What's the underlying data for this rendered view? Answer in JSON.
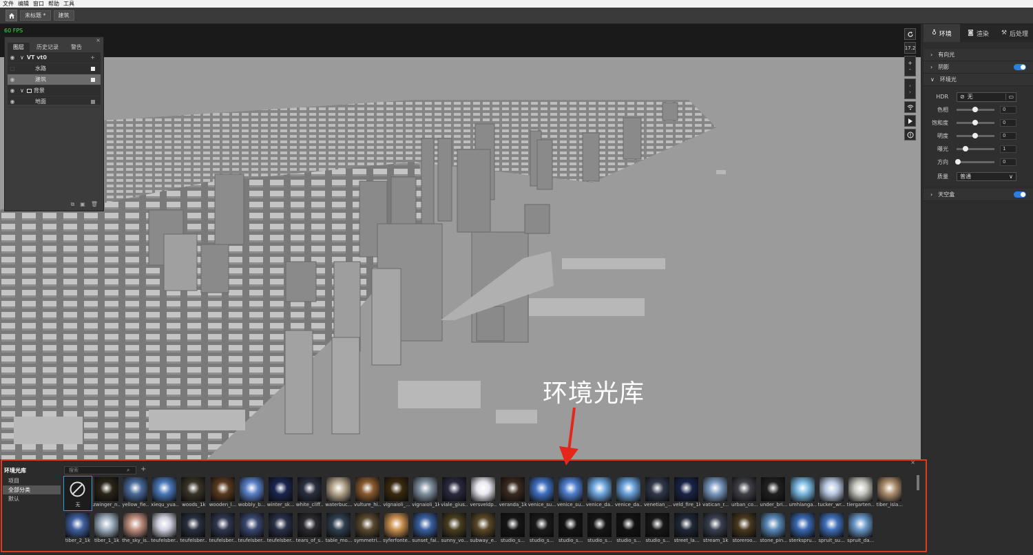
{
  "menu": [
    "文件",
    "编辑",
    "窗口",
    "帮助",
    "工具"
  ],
  "tabs": {
    "untitled": "未标题 *",
    "building": "建筑"
  },
  "viewport": {
    "fps": "60 FPS",
    "zoom": "17.2",
    "plus": "+",
    "minus": "-"
  },
  "layers": {
    "tabs": [
      "图层",
      "历史记录",
      "警告"
    ],
    "rows": [
      {
        "label": "VT vt0"
      },
      {
        "label": "水路"
      },
      {
        "label": "建筑"
      },
      {
        "label": "背景"
      },
      {
        "label": "地面"
      }
    ]
  },
  "right": {
    "tabs": [
      "环境",
      "渲染",
      "后处理"
    ],
    "sections": {
      "directional": "有向光",
      "shadow": "阴影",
      "ambient": "环境光",
      "skybox": "天空盒"
    },
    "hdr_label": "HDR",
    "hdr_value": "无",
    "params": [
      {
        "label": "色相",
        "value": "0",
        "fraction": 0.5
      },
      {
        "label": "饱和度",
        "value": "0",
        "fraction": 0.5
      },
      {
        "label": "明度",
        "value": "0",
        "fraction": 0.5
      },
      {
        "label": "曝光",
        "value": "1",
        "fraction": 0.2
      },
      {
        "label": "方向",
        "value": "0",
        "fraction": 0.0
      }
    ],
    "quality_label": "质量",
    "quality_value": "普通"
  },
  "library": {
    "title": "环境光库",
    "categories": [
      "项目",
      "全部分类",
      "默认"
    ],
    "search_placeholder": "搜索",
    "row1": [
      {
        "n": "无",
        "c": "#1e1e1e"
      },
      {
        "n": "zwinger_n...",
        "c": "#2a2418"
      },
      {
        "n": "yellow_fie...",
        "c": "#4a6a9a"
      },
      {
        "n": "xiequ_yua...",
        "c": "#4a78b8"
      },
      {
        "n": "woods_1k",
        "c": "#3a3428"
      },
      {
        "n": "wooden_l...",
        "c": "#5a3a20"
      },
      {
        "n": "wobbly_b...",
        "c": "#5a80c8"
      },
      {
        "n": "winter_sk...",
        "c": "#1a2650"
      },
      {
        "n": "white_cliff...",
        "c": "#2a3040"
      },
      {
        "n": "waterbuc...",
        "c": "#b8a890"
      },
      {
        "n": "vulture_hi...",
        "c": "#8a5a30"
      },
      {
        "n": "vignaioli_...",
        "c": "#3a2a10"
      },
      {
        "n": "vignaioli_1k",
        "c": "#8090a0"
      },
      {
        "n": "viale_gius...",
        "c": "#2a2a40"
      },
      {
        "n": "versveldp...",
        "c": "#e8e8f0"
      },
      {
        "n": "veranda_1k",
        "c": "#3a2a20"
      },
      {
        "n": "venice_su...",
        "c": "#4070c0"
      },
      {
        "n": "venice_su...",
        "c": "#5080d0"
      },
      {
        "n": "venice_da...",
        "c": "#70a8e0"
      },
      {
        "n": "venice_da...",
        "c": "#68a0d8"
      },
      {
        "n": "venetian_...",
        "c": "#30384a"
      },
      {
        "n": "veld_fire_1k",
        "c": "#1a2448"
      },
      {
        "n": "vatican_r...",
        "c": "#7a98c0"
      },
      {
        "n": "urban_co...",
        "c": "#404048"
      },
      {
        "n": "under_bri...",
        "c": "#202020"
      },
      {
        "n": "umhlanga...",
        "c": "#7ab8e0"
      },
      {
        "n": "tucker_wr...",
        "c": "#b8c8e0"
      },
      {
        "n": "tiergarten...",
        "c": "#c8c8c0"
      },
      {
        "n": "tiber_isla...",
        "c": "#b09070"
      }
    ],
    "row2": [
      {
        "n": "tiber_2_1k",
        "c": "#4060a0"
      },
      {
        "n": "tiber_1_1k",
        "c": "#a0b0c0"
      },
      {
        "n": "the_sky_is...",
        "c": "#c09080"
      },
      {
        "n": "teufelsber...",
        "c": "#d0d0e0"
      },
      {
        "n": "teufelsber...",
        "c": "#2a3040"
      },
      {
        "n": "teufelsber...",
        "c": "#303850"
      },
      {
        "n": "teufelsber...",
        "c": "#3a4870"
      },
      {
        "n": "teufelsber...",
        "c": "#2a3048"
      },
      {
        "n": "tears_of_s...",
        "c": "#2a2a30"
      },
      {
        "n": "table_mo...",
        "c": "#304050"
      },
      {
        "n": "symmetri...",
        "c": "#5a4a30"
      },
      {
        "n": "syferfonte...",
        "c": "#c89050"
      },
      {
        "n": "sunset_fai...",
        "c": "#3a60a0"
      },
      {
        "n": "sunny_vo...",
        "c": "#4a4020"
      },
      {
        "n": "subway_e...",
        "c": "#5a4828"
      },
      {
        "n": "studio_s...",
        "c": "#151515"
      },
      {
        "n": "studio_s...",
        "c": "#1a1a1a"
      },
      {
        "n": "studio_s...",
        "c": "#141414"
      },
      {
        "n": "studio_s...",
        "c": "#161616"
      },
      {
        "n": "studio_s...",
        "c": "#121212"
      },
      {
        "n": "studio_s...",
        "c": "#181818"
      },
      {
        "n": "street_la...",
        "c": "#202838"
      },
      {
        "n": "stream_1k",
        "c": "#3a4050"
      },
      {
        "n": "storeroo...",
        "c": "#4a3a20"
      },
      {
        "n": "stone_pin...",
        "c": "#5a8ab8"
      },
      {
        "n": "sterkspru...",
        "c": "#3a68b0"
      },
      {
        "n": "spruit_su...",
        "c": "#4070b8"
      },
      {
        "n": "spruit_da...",
        "c": "#6a98c8"
      }
    ]
  },
  "annotation": "环境光库"
}
